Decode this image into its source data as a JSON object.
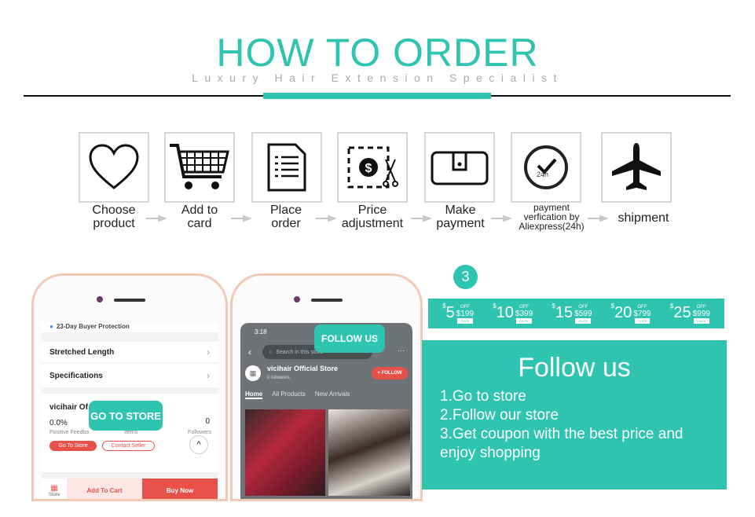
{
  "header": {
    "title": "HOW TO ORDER",
    "subtitle": "Luxury Hair Extension Specialist"
  },
  "colors": {
    "accent": "#2ec4b0",
    "red": "#e8514a"
  },
  "steps": [
    {
      "icon": "heart-icon",
      "label1": "Choose",
      "label2": "product"
    },
    {
      "icon": "shopping-cart-icon",
      "label1": "Add to",
      "label2": "card"
    },
    {
      "icon": "document-icon",
      "label1": "Place",
      "label2": "order"
    },
    {
      "icon": "price-cut-icon",
      "label1": "Price",
      "label2": "adjustment"
    },
    {
      "icon": "wallet-icon",
      "label1": "Make",
      "label2": "payment"
    },
    {
      "icon": "clock-check-icon",
      "icon_text": "24h",
      "label1": "payment",
      "label2": "verfication by",
      "label3": "Aliexpress(24h)"
    },
    {
      "icon": "airplane-icon",
      "label1": "shipment"
    }
  ],
  "phone1": {
    "buyer_protection": "23-Day Buyer Protection",
    "rows": [
      "Stretched Length",
      "Specifications"
    ],
    "store_name": "vicihair Of",
    "feedback_value": "0.0%",
    "feedback_label": "Positive Feedba",
    "items_label": "Items",
    "followers_value": "0",
    "followers_label": "Followers",
    "go_to_store": "Go To Store",
    "contact_seller": "Contact Seller",
    "store_tab": "Store",
    "add_to_cart": "Add To Cart",
    "buy_now": "Buy Now",
    "bubble": "GO TO STORE"
  },
  "phone2": {
    "time": "3:18",
    "search_placeholder": "Search in this store",
    "store_name": "vicihair Official Store",
    "followers": "0 followers",
    "follow_button": "+ FOLLOW",
    "tabs": [
      "Home",
      "All Products",
      "New Arrivals"
    ],
    "bubble": "FOLLOW US"
  },
  "step_number": "3",
  "coupons": [
    {
      "amount": "5",
      "min": "$199"
    },
    {
      "amount": "10",
      "min": "$399"
    },
    {
      "amount": "15",
      "min": "$599"
    },
    {
      "amount": "20",
      "min": "$799"
    },
    {
      "amount": "25",
      "min": "$999"
    }
  ],
  "coupon_labels": {
    "currency": "$",
    "off": "OFF",
    "click": "CLICK"
  },
  "follow": {
    "title": "Follow us",
    "lines": [
      "1.Go to store",
      "2.Follow our store",
      "3.Get coupon with the best price and",
      "enjoy shopping"
    ]
  }
}
